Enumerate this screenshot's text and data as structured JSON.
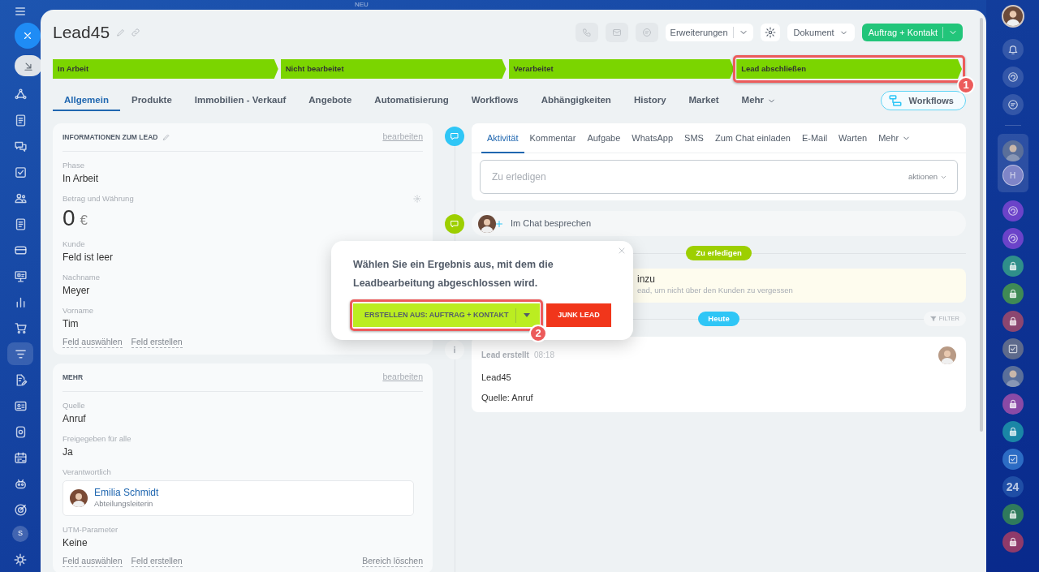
{
  "top_label": "NEU",
  "user_initial": "S",
  "title": "Lead45",
  "header_buttons": {
    "extensions": "Erweiterungen",
    "document": "Dokument",
    "primary": "Auftrag + Kontakt"
  },
  "stages": [
    {
      "label": "In Arbeit"
    },
    {
      "label": "Nicht bearbeitet"
    },
    {
      "label": "Verarbeitet"
    },
    {
      "label": "Lead abschließen",
      "callout": "1"
    }
  ],
  "tabs": [
    {
      "label": "Allgemein",
      "selected": true,
      "kind": "tab"
    },
    {
      "label": "Produkte",
      "selected": false,
      "kind": "tab"
    },
    {
      "label": "Immobilien - Verkauf",
      "selected": false,
      "kind": "tab"
    },
    {
      "label": "Angebote",
      "selected": false,
      "kind": "tab"
    },
    {
      "label": "Automatisierung",
      "selected": false,
      "kind": "tab"
    },
    {
      "label": "Workflows",
      "selected": false,
      "kind": "tab"
    },
    {
      "label": "Abhängigkeiten",
      "selected": false,
      "kind": "tab"
    },
    {
      "label": "History",
      "selected": false,
      "kind": "tab"
    },
    {
      "label": "Market",
      "selected": false,
      "kind": "tab"
    },
    {
      "label": "Mehr",
      "selected": false,
      "kind": "menu"
    }
  ],
  "workflows_button": "Workflows",
  "cards": [
    {
      "title": "INFORMATIONEN ZUM LEAD",
      "editable_title": true,
      "action": "bearbeiten",
      "fields": [
        {
          "kind": "text",
          "label": "Phase",
          "value": "In Arbeit"
        },
        {
          "kind": "money",
          "label": "Betrag und Währung",
          "value": "0",
          "currency": "€"
        },
        {
          "kind": "text",
          "label": "Kunde",
          "value": "Feld ist leer"
        },
        {
          "kind": "text",
          "label": "Nachname",
          "value": "Meyer"
        },
        {
          "kind": "text",
          "label": "Vorname",
          "value": "Tim"
        }
      ],
      "links": [
        "Feld auswählen",
        "Feld erstellen"
      ]
    },
    {
      "title": "MEHR",
      "editable_title": false,
      "action": "bearbeiten",
      "fields": [
        {
          "kind": "text",
          "label": "Quelle",
          "value": "Anruf"
        },
        {
          "kind": "text",
          "label": "Freigegeben für alle",
          "value": "Ja"
        },
        {
          "kind": "person",
          "label": "Verantwortlich",
          "name": "Emilia Schmidt",
          "role": "Abteilungsleiterin"
        },
        {
          "kind": "text",
          "label": "UTM-Parameter",
          "value": "Keine"
        }
      ],
      "links": [
        "Feld auswählen",
        "Feld erstellen"
      ],
      "delete_link": "Bereich löschen"
    }
  ],
  "activity": {
    "tabs": [
      {
        "label": "Aktivität",
        "selected": true,
        "kind": "tab"
      },
      {
        "label": "Kommentar",
        "selected": false,
        "kind": "tab"
      },
      {
        "label": "Aufgabe",
        "selected": false,
        "kind": "tab"
      },
      {
        "label": "WhatsApp",
        "selected": false,
        "kind": "tab"
      },
      {
        "label": "SMS",
        "selected": false,
        "kind": "tab"
      },
      {
        "label": "Zum Chat einladen",
        "selected": false,
        "kind": "tab"
      },
      {
        "label": "E-Mail",
        "selected": false,
        "kind": "tab"
      },
      {
        "label": "Warten",
        "selected": false,
        "kind": "tab"
      },
      {
        "label": "Mehr",
        "selected": false,
        "kind": "menu"
      }
    ],
    "placeholder": "Zu erledigen",
    "actions": "aktionen"
  },
  "chat": "Im Chat besprechen",
  "todo_badge": "Zu erledigen",
  "todo_notice": {
    "title": "inzu",
    "text": "ead, um nicht über den Kunden zu vergessen"
  },
  "today_badge": "Heute",
  "filter": "FILTER",
  "history": {
    "title": "Lead erstellt",
    "time": "08:18",
    "lines": [
      "Lead45",
      "Quelle: Anruf"
    ]
  },
  "popup": {
    "message": "Wählen Sie ein Ergebnis aus, mit dem die Leadbearbeitung abgeschlossen wird.",
    "primary": "ERSTELLEN AUS: AUFTRAG + KONTAKT",
    "primary_callout": "2",
    "secondary": "JUNK LEAD"
  },
  "right_rail": [
    {
      "kind": "avatar"
    },
    {
      "kind": "letter",
      "text": "H"
    },
    {
      "kind": "app",
      "color": "#6b43c9"
    },
    {
      "kind": "app",
      "color": "#6b43c9"
    },
    {
      "kind": "lock",
      "color": "#2f8f8a"
    },
    {
      "kind": "lock",
      "color": "#3f8a55"
    },
    {
      "kind": "lock",
      "color": "#8c4670"
    },
    {
      "kind": "check",
      "color": "#5d6a8c"
    },
    {
      "kind": "avatar"
    },
    {
      "kind": "lock",
      "color": "#8a4aa6"
    },
    {
      "kind": "lock",
      "color": "#1a86a6"
    },
    {
      "kind": "check",
      "color": "#2c6cc4"
    },
    {
      "kind": "letter",
      "text": "24"
    },
    {
      "kind": "lock",
      "color": "#2f7a5c"
    },
    {
      "kind": "lock",
      "color": "#8f3a6a"
    }
  ]
}
